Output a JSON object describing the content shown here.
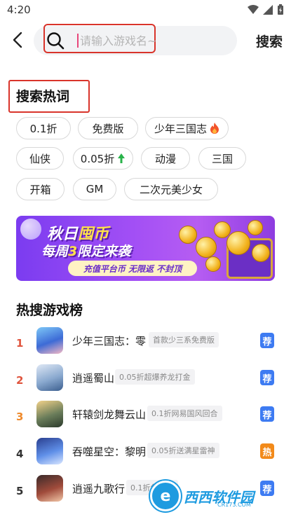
{
  "status_bar": {
    "time": "4:20"
  },
  "header": {
    "search_placeholder": "请输入游戏名~",
    "search_button": "搜索"
  },
  "hot_words": {
    "title": "搜索热词",
    "tags": [
      {
        "label": "0.1折"
      },
      {
        "label": "免费版"
      },
      {
        "label": "少年三国志"
      },
      {
        "label": "仙侠"
      },
      {
        "label": "0.05折"
      },
      {
        "label": "动漫"
      },
      {
        "label": "三国"
      },
      {
        "label": "开箱"
      },
      {
        "label": "GM"
      },
      {
        "label": "二次元美少女"
      }
    ]
  },
  "banner": {
    "title_part1": "秋日",
    "title_part2": "囤币",
    "subtitle_part1": "每周",
    "subtitle_num": "3",
    "subtitle_part2": "限定来袭",
    "strip": "充值平台币 无限返 不封顶"
  },
  "ranking": {
    "title": "热搜游戏榜",
    "items": [
      {
        "rank": "1",
        "name": "少年三国志：零",
        "tag": "首款少三系免费版",
        "badge": "荐",
        "badge_color": "#3d7bf2",
        "rank_color": "#e0553e"
      },
      {
        "rank": "2",
        "name": "逍遥蜀山",
        "tag": "0.05折超爆养龙打金",
        "badge": "荐",
        "badge_color": "#3d7bf2",
        "rank_color": "#e0553e"
      },
      {
        "rank": "3",
        "name": "轩辕剑龙舞云山",
        "tag": "0.1折网易国风回合",
        "badge": "荐",
        "badge_color": "#3d7bf2",
        "rank_color": "#ef8a2c"
      },
      {
        "rank": "4",
        "name": "吞噬星空：黎明",
        "tag": "0.05折送满星雷神",
        "badge": "热",
        "badge_color": "#f28a1a",
        "rank_color": "#333333"
      },
      {
        "rank": "5",
        "name": "逍遥九歌行",
        "tag": "0.1折免费送",
        "badge": "荐",
        "badge_color": "#3d7bf2",
        "rank_color": "#333333"
      }
    ]
  },
  "watermark": {
    "text": "西西软件园",
    "url": "CR173.COM",
    "logo_char": "e"
  }
}
